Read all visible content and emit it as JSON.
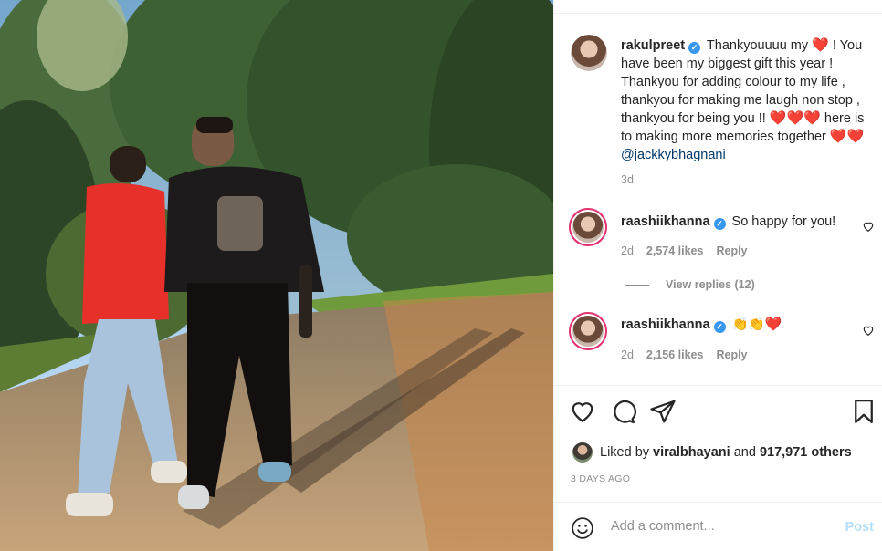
{
  "post": {
    "author": "rakulpreet",
    "caption_parts": [
      "Thankyouuuu my",
      "! You have been my biggest gift this year ! Thankyou for adding colour to my life , thankyou for making me laugh non stop , thankyou for being you !!",
      "here is to making more memories together"
    ],
    "mention": "@jackkybhagnani",
    "caption_time": "3d"
  },
  "comments": [
    {
      "user": "raashiikhanna",
      "text": "So happy for you!",
      "time": "2d",
      "likes": "2,574 likes",
      "reply": "Reply"
    },
    {
      "user": "raashiikhanna",
      "text": "👏👏",
      "time": "2d",
      "likes": "2,156 likes",
      "reply": "Reply"
    }
  ],
  "view_replies": "View replies (12)",
  "likes": {
    "prefix": "Liked by",
    "user": "viralbhayani",
    "and": "and",
    "count": "917,971 others"
  },
  "timeago": "3 DAYS AGO",
  "add_comment": {
    "placeholder": "Add a comment...",
    "post_label": "Post"
  },
  "icons": {
    "verified": "verified-badge-icon",
    "heart": "heart-icon",
    "comment": "comment-icon",
    "share": "share-icon",
    "save": "bookmark-icon",
    "emoji": "emoji-icon"
  },
  "colors": {
    "accent": "#3897f0",
    "heart": "#e0141e",
    "post_disabled": "#b2dffc",
    "muted": "#8e8e8e"
  }
}
